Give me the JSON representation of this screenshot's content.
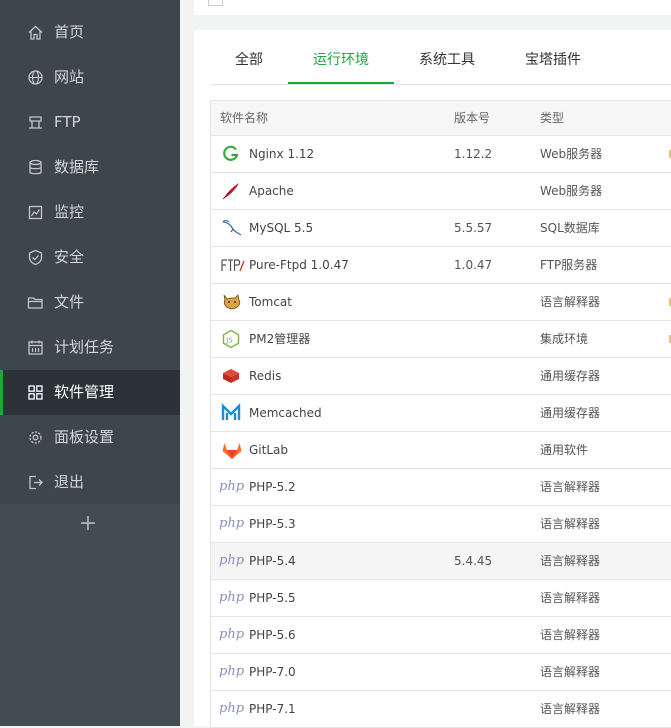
{
  "sidebar": {
    "items": [
      {
        "label": "首页",
        "icon": "home-icon",
        "slug": "home"
      },
      {
        "label": "网站",
        "icon": "globe-icon",
        "slug": "website"
      },
      {
        "label": "FTP",
        "icon": "ftp-icon",
        "slug": "ftp"
      },
      {
        "label": "数据库",
        "icon": "database-icon",
        "slug": "database"
      },
      {
        "label": "监控",
        "icon": "monitor-icon",
        "slug": "monitor"
      },
      {
        "label": "安全",
        "icon": "shield-icon",
        "slug": "security"
      },
      {
        "label": "文件",
        "icon": "folder-icon",
        "slug": "files"
      },
      {
        "label": "计划任务",
        "icon": "calendar-icon",
        "slug": "crontab"
      },
      {
        "label": "软件管理",
        "icon": "apps-grid-icon",
        "slug": "software",
        "active": true
      },
      {
        "label": "面板设置",
        "icon": "gear-icon",
        "slug": "settings"
      },
      {
        "label": "退出",
        "icon": "logout-icon",
        "slug": "logout"
      }
    ],
    "add_label": "+"
  },
  "tabs": [
    {
      "label": "全部"
    },
    {
      "label": "运行环境",
      "active": true
    },
    {
      "label": "系统工具"
    },
    {
      "label": "宝塔插件"
    }
  ],
  "table": {
    "headers": {
      "name": "软件名称",
      "version": "版本号",
      "type": "类型"
    },
    "rows": [
      {
        "name": "Nginx 1.12",
        "version": "1.12.2",
        "type": "Web服务器",
        "icon": "nginx-icon"
      },
      {
        "name": "Apache",
        "version": "",
        "type": "Web服务器",
        "icon": "apache-feather-icon"
      },
      {
        "name": "MySQL 5.5",
        "version": "5.5.57",
        "type": "SQL数据库",
        "icon": "mysql-dolphin-icon"
      },
      {
        "name": "Pure-Ftpd 1.0.47",
        "version": "1.0.47",
        "type": "FTP服务器",
        "icon": "ftp-logo-icon"
      },
      {
        "name": "Tomcat",
        "version": "",
        "type": "语言解释器",
        "icon": "tomcat-icon"
      },
      {
        "name": "PM2管理器",
        "version": "",
        "type": "集成环境",
        "icon": "nodejs-icon"
      },
      {
        "name": "Redis",
        "version": "",
        "type": "通用缓存器",
        "icon": "redis-icon"
      },
      {
        "name": "Memcached",
        "version": "",
        "type": "通用缓存器",
        "icon": "memcached-icon"
      },
      {
        "name": "GitLab",
        "version": "",
        "type": "通用软件",
        "icon": "gitlab-icon"
      },
      {
        "name": "PHP-5.2",
        "version": "",
        "type": "语言解释器",
        "icon": "php-icon"
      },
      {
        "name": "PHP-5.3",
        "version": "",
        "type": "语言解释器",
        "icon": "php-icon"
      },
      {
        "name": "PHP-5.4",
        "version": "5.4.45",
        "type": "语言解释器",
        "icon": "php-icon",
        "highlight": true
      },
      {
        "name": "PHP-5.5",
        "version": "",
        "type": "语言解释器",
        "icon": "php-icon"
      },
      {
        "name": "PHP-5.6",
        "version": "",
        "type": "语言解释器",
        "icon": "php-icon"
      },
      {
        "name": "PHP-7.0",
        "version": "",
        "type": "语言解释器",
        "icon": "php-icon"
      },
      {
        "name": "PHP-7.1",
        "version": "",
        "type": "语言解释器",
        "icon": "php-icon"
      }
    ],
    "php_glyph": "php"
  },
  "colors": {
    "accent": "#20a53a",
    "sidebar_bg": "#3d464d",
    "sidebar_active_bg": "#2c3338"
  }
}
